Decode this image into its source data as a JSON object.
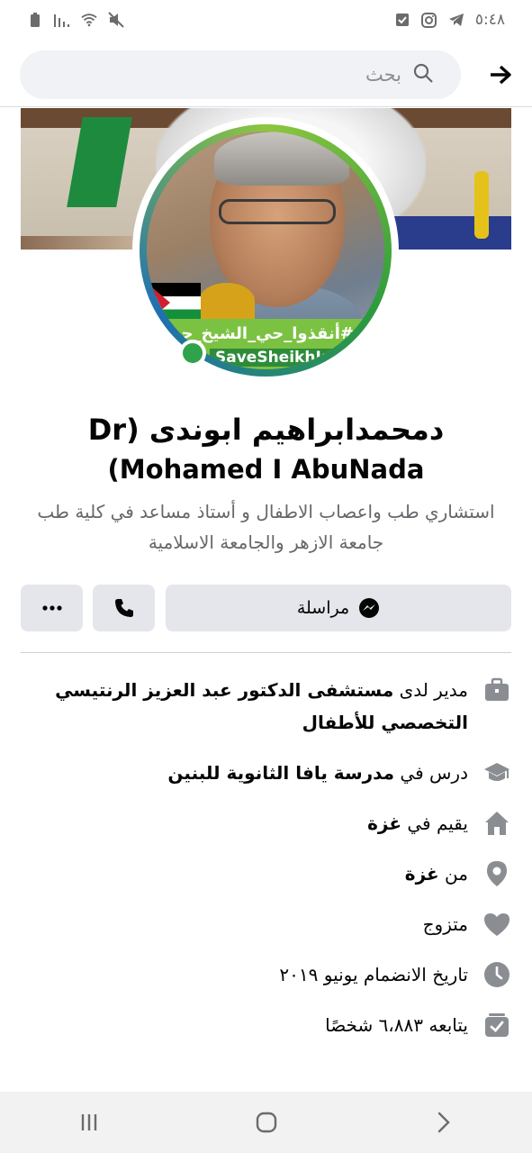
{
  "status_bar": {
    "time": "٥:٤٨",
    "icons": [
      "battery-icon",
      "signal-icon",
      "wifi-icon",
      "mute-icon",
      "checkbox-icon",
      "instagram-icon",
      "telegram-icon"
    ]
  },
  "search": {
    "placeholder": "بحث",
    "back_icon": "arrow-right-icon"
  },
  "profile": {
    "name_line1": "دمحمدابراهيم ابوندى (Dr",
    "name_line2": "(Mohamed I AbuNada",
    "bio": "استشاري طب واعصاب الاطفال و أستاذ مساعد في كلية طب جامعة الازهر والجامعة الاسلامية",
    "avatar_banner_arabic": "#أنقذوا_حي_الشيخ_جراح",
    "avatar_banner_latin": "SaveSheikhJarrah",
    "online": true
  },
  "actions": {
    "message_label": "مراسلة",
    "call_icon": "phone-icon",
    "more_icon": "more-icon"
  },
  "details": [
    {
      "icon": "briefcase-icon",
      "prefix": "مدير لدى ",
      "bold": "مستشفى الدكتور عبد العزيز الرنتيسي التخصصي للأطفال"
    },
    {
      "icon": "graduation-cap-icon",
      "prefix": "درس في ",
      "bold": "مدرسة يافا الثانوية للبنين"
    },
    {
      "icon": "home-icon",
      "prefix": "يقيم في ",
      "bold": "غزة"
    },
    {
      "icon": "location-pin-icon",
      "prefix": "من ",
      "bold": "غزة"
    },
    {
      "icon": "heart-icon",
      "prefix": "متزوج",
      "bold": ""
    },
    {
      "icon": "clock-icon",
      "prefix": "تاريخ الانضمام يونيو ٢٠١٩",
      "bold": ""
    },
    {
      "icon": "followers-icon",
      "prefix": "يتابعه ٦،٨٨٣ شخصًا",
      "bold": ""
    }
  ],
  "colors": {
    "accent_green": "#31a24c",
    "button_bg": "#e4e6eb",
    "muted_text": "#65676b"
  },
  "nav_bar": [
    "recent-apps-icon",
    "home-button-icon",
    "back-chevron-icon"
  ]
}
